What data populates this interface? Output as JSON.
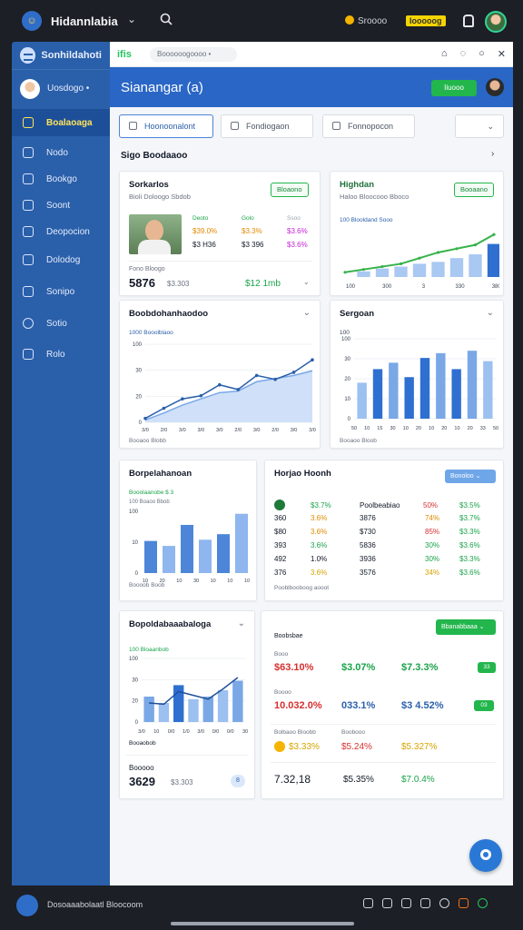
{
  "os": {
    "app_title": "Hidannlabia",
    "coins_label": "Sroooo",
    "chip_label": "Iooooog",
    "taskbar_text": "Dosoaaabolaatl Bloocoom"
  },
  "sidebar": {
    "brand": "Sonhildahoti",
    "user": "Uosdogo •",
    "items": [
      {
        "label": "Boalaoaga"
      },
      {
        "label": "Nodo"
      },
      {
        "label": "Bookgo"
      },
      {
        "label": "Soont"
      },
      {
        "label": "Deopocion"
      },
      {
        "label": "Dolodog"
      },
      {
        "label": "Sonipo"
      },
      {
        "label": "Sotio"
      },
      {
        "label": "Rolo"
      }
    ]
  },
  "window": {
    "tab_label": "ifis",
    "url": "Boooooogoooo •",
    "header_title": "Sianangar (a)",
    "header_button": "Iiuooo"
  },
  "filters": [
    "Hoonoonalont",
    "Fondiogaon",
    "Fonnopocon"
  ],
  "section_label": "Sigo Boodaaoo",
  "cards": {
    "profile": {
      "title": "Sorkarlos",
      "subtitle": "Bioli Doloogo Sbdob",
      "button": "Bloaono",
      "cols": [
        {
          "label": "Deoto",
          "value": "$39.0%",
          "color": "green"
        },
        {
          "label": "Golo",
          "value": "$3.3%",
          "color": "orange"
        },
        {
          "label": "Ssoo",
          "value": "$3.6%",
          "color": "purple"
        }
      ],
      "rows2": [
        "$3 H36",
        "$3 396",
        "$3.6%"
      ],
      "foot_label": "Fono Bloogo",
      "foot_value": "5876",
      "foot_sub": "$3.303",
      "foot_right": "$12 1mb"
    },
    "trend": {
      "title": "Highdan",
      "subtitle": "Haloo Bloocooo Bboco",
      "button": "Booaano",
      "legend": "100 Blooldand Sooo"
    },
    "line": {
      "title": "Boobdohanhaodoo",
      "legend": "1000 Booolblaoo",
      "foot": "Booaoo Blobb"
    },
    "bars1": {
      "title": "Sergoan",
      "legend": "100",
      "foot": "Booaoo Bloob"
    },
    "bars2": {
      "title": "Borpelahanoan",
      "legend": "Booolaanobe $ 3",
      "sublegend": "100 Boaoo Bbob",
      "foot": "Boooob Boob"
    },
    "table": {
      "title": "Horjao Hoonh",
      "dropdown": "Bonoloo",
      "header": [
        "",
        "$3.7%",
        "Poolbeabiao",
        "50%",
        "$3.5%"
      ],
      "rows": [
        [
          "360",
          "3.6%",
          "3876",
          "74%",
          "$3.7%"
        ],
        [
          "$80",
          "3.6%",
          "$730",
          "85%",
          "$3.3%"
        ],
        [
          "393",
          "3.6%",
          "5836",
          "30%",
          "$3.6%"
        ],
        [
          "492",
          "1.0%",
          "3936",
          "30%",
          "$3.3%"
        ],
        [
          "376",
          "3.6%",
          "3576",
          "34%",
          "$3.6%"
        ]
      ],
      "foot": "Pooblbooboog aooot"
    },
    "combo": {
      "title": "Bopoldabaaabaloga",
      "legend": "100 Bloaanbob",
      "legend2": "Booaobob",
      "foot_label": "Booooo",
      "foot_value": "3629",
      "foot_sub": "$3.303",
      "badge": "8"
    },
    "stats": {
      "title": "Boobsbae",
      "button": "Bbanabbaaa",
      "rows": [
        {
          "label": "Booo",
          "a": "$63.10%",
          "b": "$3.07%",
          "c": "$7.3.3%",
          "badge": "33"
        },
        {
          "label": "Boooo",
          "a": "10.032.0%",
          "b": "033.1%",
          "c": "$3 4.52%",
          "badge": "03"
        },
        {
          "label": "Bolbaoo Bloobb",
          "label2": "Boobooo",
          "a": "$3.33%",
          "b": "$5.24%",
          "c": "$5.327%"
        },
        {
          "label": "",
          "a": "7.32,18",
          "b": "$5.35%",
          "c": "$7.0.4%"
        }
      ]
    }
  },
  "chart_data": [
    {
      "type": "area",
      "title": "Highdan",
      "x": [
        "100",
        "300",
        "3",
        "330",
        "380"
      ],
      "series": [
        {
          "values": [
            10,
            16,
            22,
            28,
            40,
            52,
            60,
            68,
            90
          ]
        },
        {
          "values": [
            6,
            12,
            18,
            22,
            28,
            32,
            40,
            48,
            70
          ]
        }
      ]
    },
    {
      "type": "line",
      "title": "Boobdohanhaodoo",
      "x": [
        "3/0",
        "2/0",
        "3/0",
        "3/0",
        "3/0",
        "2/0",
        "3/0",
        "2/0",
        "3/0",
        "3/0"
      ],
      "yticks": [
        "0",
        "20",
        "30",
        "100"
      ],
      "series": [
        {
          "values": [
            5,
            18,
            30,
            34,
            48,
            42,
            60,
            55,
            64,
            80
          ]
        },
        {
          "values": [
            3,
            12,
            22,
            30,
            38,
            40,
            52,
            56,
            60,
            66
          ]
        }
      ]
    },
    {
      "type": "bar",
      "title": "Sergoan",
      "x": [
        "50",
        "10",
        "15",
        "30",
        "10",
        "20",
        "10",
        "20",
        "10",
        "20",
        "33",
        "50"
      ],
      "yticks": [
        "0",
        "10",
        "20",
        "30",
        "100"
      ],
      "values": [
        45,
        62,
        70,
        52,
        76,
        82,
        62,
        85,
        72
      ]
    },
    {
      "type": "bar",
      "title": "Borpelahanoan",
      "x": [
        "10",
        "20",
        "10",
        "30",
        "10",
        "10",
        "10"
      ],
      "yticks": [
        "0",
        "10",
        "100"
      ],
      "values": [
        52,
        44,
        78,
        54,
        63,
        96
      ]
    },
    {
      "type": "bar",
      "title": "Bopoldabaaabaloga",
      "x": [
        "3/0",
        "10",
        "0/0",
        "1/0",
        "3/0",
        "0/0",
        "0/0",
        "30"
      ],
      "yticks": [
        "0",
        "20",
        "30",
        "100"
      ],
      "values": [
        40,
        30,
        58,
        36,
        40,
        50,
        65
      ],
      "line": [
        30,
        28,
        48,
        42,
        36,
        52,
        70
      ]
    }
  ]
}
